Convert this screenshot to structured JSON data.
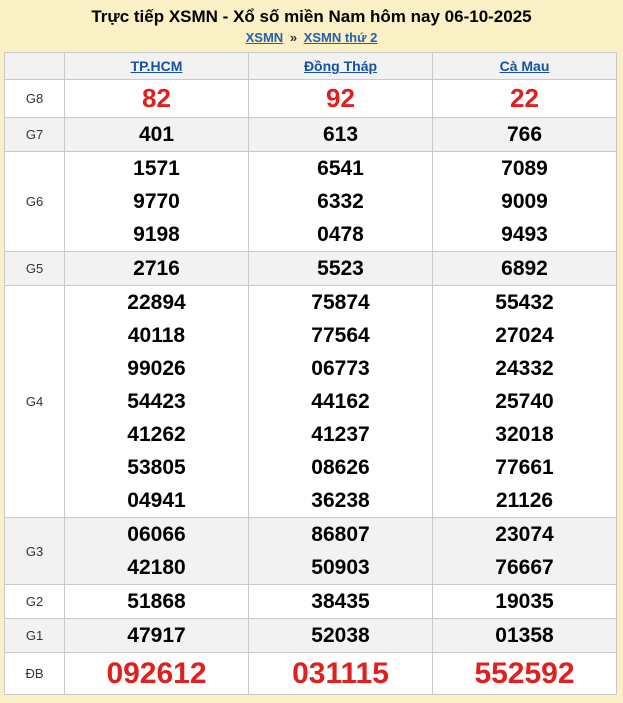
{
  "page": {
    "title": "Trực tiếp XSMN - Xổ số miền Nam hôm nay 06-10-2025",
    "breadcrumb": {
      "home": "XSMN",
      "separator": "»",
      "current": "XSMN thứ 2"
    }
  },
  "colors": {
    "page_background": "#faf0c6",
    "link_blue": "#15519e",
    "breadcrumb_blue": "#2360b0",
    "number_red": "#e0201e",
    "number_black": "#000000",
    "row_shade": "#f2f2f2",
    "border_gray": "#c9c9c9"
  },
  "table": {
    "columns": [
      {
        "label": "TP.HCM",
        "slug": "tp-hcm"
      },
      {
        "label": "Đồng Tháp",
        "slug": "dong-thap"
      },
      {
        "label": "Cà Mau",
        "slug": "ca-mau"
      }
    ],
    "rows": [
      {
        "prize": "G8",
        "emphasis": "red-large",
        "values": [
          [
            "82"
          ],
          [
            "92"
          ],
          [
            "22"
          ]
        ]
      },
      {
        "prize": "G7",
        "values": [
          [
            "401"
          ],
          [
            "613"
          ],
          [
            "766"
          ]
        ]
      },
      {
        "prize": "G6",
        "values": [
          [
            "1571",
            "9770",
            "9198"
          ],
          [
            "6541",
            "6332",
            "0478"
          ],
          [
            "7089",
            "9009",
            "9493"
          ]
        ]
      },
      {
        "prize": "G5",
        "values": [
          [
            "2716"
          ],
          [
            "5523"
          ],
          [
            "6892"
          ]
        ]
      },
      {
        "prize": "G4",
        "values": [
          [
            "22894",
            "40118",
            "99026",
            "54423",
            "41262",
            "53805",
            "04941"
          ],
          [
            "75874",
            "77564",
            "06773",
            "44162",
            "41237",
            "08626",
            "36238"
          ],
          [
            "55432",
            "27024",
            "24332",
            "25740",
            "32018",
            "77661",
            "21126"
          ]
        ]
      },
      {
        "prize": "G3",
        "values": [
          [
            "06066",
            "42180"
          ],
          [
            "86807",
            "50903"
          ],
          [
            "23074",
            "76667"
          ]
        ]
      },
      {
        "prize": "G2",
        "values": [
          [
            "51868"
          ],
          [
            "38435"
          ],
          [
            "19035"
          ]
        ]
      },
      {
        "prize": "G1",
        "values": [
          [
            "47917"
          ],
          [
            "52038"
          ],
          [
            "01358"
          ]
        ]
      },
      {
        "prize": "ĐB",
        "emphasis": "red-xlarge",
        "values": [
          [
            "092612"
          ],
          [
            "031115"
          ],
          [
            "552592"
          ]
        ]
      }
    ]
  }
}
